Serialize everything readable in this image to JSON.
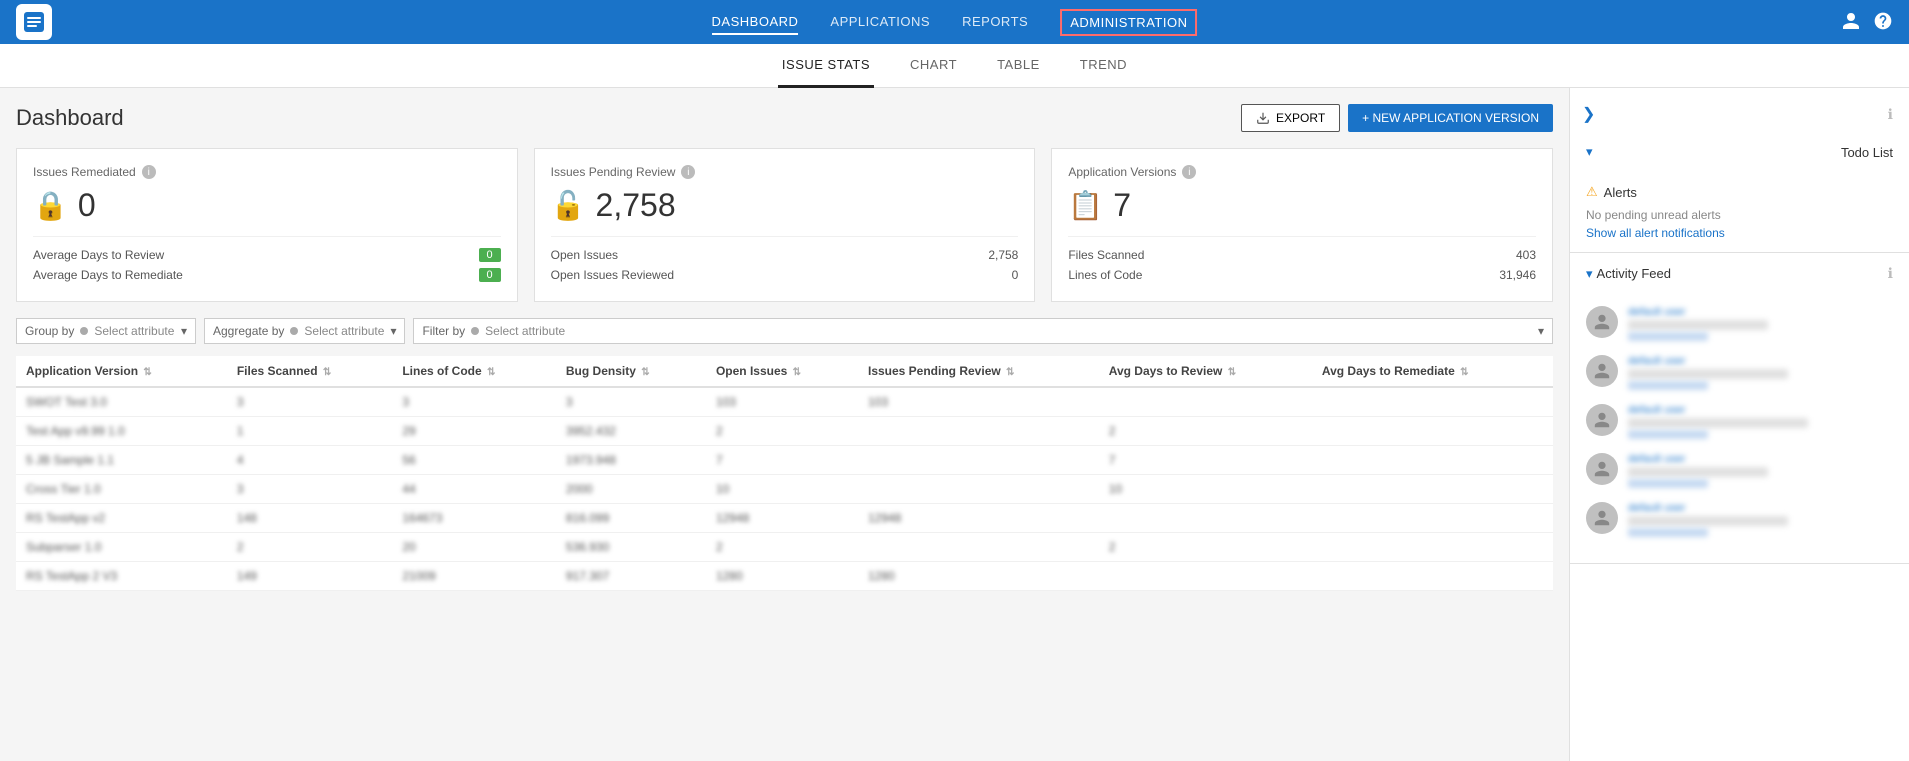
{
  "header": {
    "logo_alt": "Threadfix Logo",
    "nav_items": [
      {
        "label": "DASHBOARD",
        "active": true,
        "highlight": false
      },
      {
        "label": "APPLICATIONS",
        "active": false,
        "highlight": false
      },
      {
        "label": "REPORTS",
        "active": false,
        "highlight": false
      },
      {
        "label": "ADMINISTRATION",
        "active": false,
        "highlight": true
      }
    ]
  },
  "sub_nav": {
    "tabs": [
      {
        "label": "ISSUE STATS",
        "active": true
      },
      {
        "label": "CHART",
        "active": false
      },
      {
        "label": "TABLE",
        "active": false
      },
      {
        "label": "TREND",
        "active": false
      }
    ]
  },
  "page": {
    "title": "Dashboard",
    "export_label": "EXPORT",
    "new_version_label": "+ NEW APPLICATION VERSION"
  },
  "stat_cards": [
    {
      "title": "Issues Remediated",
      "value": "0",
      "rows": [
        {
          "label": "Average Days to Review",
          "value": "0",
          "badge": true
        },
        {
          "label": "Average Days to Remediate",
          "value": "0",
          "badge": true
        }
      ]
    },
    {
      "title": "Issues Pending Review",
      "value": "2,758",
      "rows": [
        {
          "label": "Open Issues",
          "value": "2,758",
          "badge": false
        },
        {
          "label": "Open Issues Reviewed",
          "value": "0",
          "badge": false
        }
      ]
    },
    {
      "title": "Application Versions",
      "value": "7",
      "rows": [
        {
          "label": "Files Scanned",
          "value": "403",
          "badge": false
        },
        {
          "label": "Lines of Code",
          "value": "31,946",
          "badge": false
        }
      ]
    }
  ],
  "filters": {
    "group_by_label": "Group by",
    "group_by_placeholder": "Select attribute",
    "aggregate_by_label": "Aggregate by",
    "aggregate_by_placeholder": "Select attribute",
    "filter_by_label": "Filter by",
    "filter_by_placeholder": "Select attribute"
  },
  "table": {
    "columns": [
      "Application Version",
      "Files Scanned",
      "Lines of Code",
      "Bug Density",
      "Open Issues",
      "Issues Pending Review",
      "Avg Days to Review",
      "Avg Days to Remediate"
    ],
    "rows": [
      [
        "SWOT Test 3.0",
        "3",
        "3",
        "3",
        "103",
        "103",
        "",
        ""
      ],
      [
        "Test App v9.99 1.0",
        "1",
        "29",
        "3952.432",
        "2",
        "",
        "2",
        ""
      ],
      [
        "5 JB Sample 1.1",
        "4",
        "56",
        "1973.948",
        "7",
        "",
        "7",
        ""
      ],
      [
        "Cross Tier 1.0",
        "3",
        "44",
        "2000",
        "10",
        "",
        "10",
        ""
      ],
      [
        "RS TestApp v2",
        "148",
        "164673",
        "816.099",
        "12948",
        "12948",
        "",
        ""
      ],
      [
        "Subparser 1.0",
        "2",
        "20",
        "536.930",
        "2",
        "",
        "2",
        ""
      ],
      [
        "RS TestApp 2 V3",
        "149",
        "21009",
        "917.307",
        "1280",
        "1280",
        "",
        ""
      ]
    ]
  },
  "sidebar": {
    "todo_label": "Todo List",
    "alerts_label": "Alerts",
    "no_alerts_msg": "No pending unread alerts",
    "show_alerts_link": "Show all alert notifications",
    "activity_label": "Activity Feed",
    "activity_items": [
      {
        "user": "default user",
        "action_blurred": true
      },
      {
        "user": "default user",
        "action_blurred": true
      },
      {
        "user": "default user",
        "action_blurred": true
      },
      {
        "user": "default user",
        "action_blurred": true
      },
      {
        "user": "default user",
        "action_blurred": true
      }
    ]
  }
}
